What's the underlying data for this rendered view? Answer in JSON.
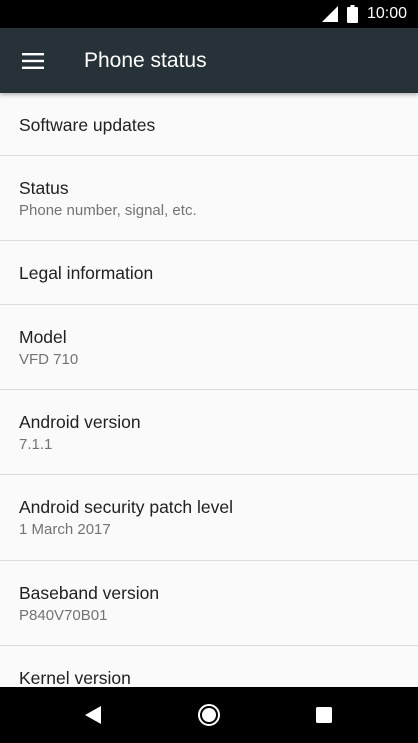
{
  "status_bar": {
    "time": "10:00",
    "icons": [
      "signal-icon",
      "battery-icon"
    ]
  },
  "app_bar": {
    "title": "Phone status",
    "menu_icon": "hamburger-menu-icon"
  },
  "items": [
    {
      "title": "Software updates",
      "subtitle": ""
    },
    {
      "title": "Status",
      "subtitle": "Phone number, signal, etc."
    },
    {
      "title": "Legal information",
      "subtitle": ""
    },
    {
      "title": "Model",
      "subtitle": "VFD 710"
    },
    {
      "title": "Android version",
      "subtitle": "7.1.1"
    },
    {
      "title": "Android security patch level",
      "subtitle": "1 March 2017"
    },
    {
      "title": "Baseband version",
      "subtitle": "P840V70B01"
    },
    {
      "title": "Kernel version",
      "subtitle": ""
    }
  ],
  "nav_bar": {
    "icons": [
      "back-icon",
      "home-icon",
      "recents-icon"
    ]
  },
  "colors": {
    "app_bar": "#263238",
    "status_bar": "#000000",
    "background": "#fafafa",
    "title_text": "#212121",
    "subtitle_text": "#737373",
    "divider": "#dcdcdc"
  }
}
